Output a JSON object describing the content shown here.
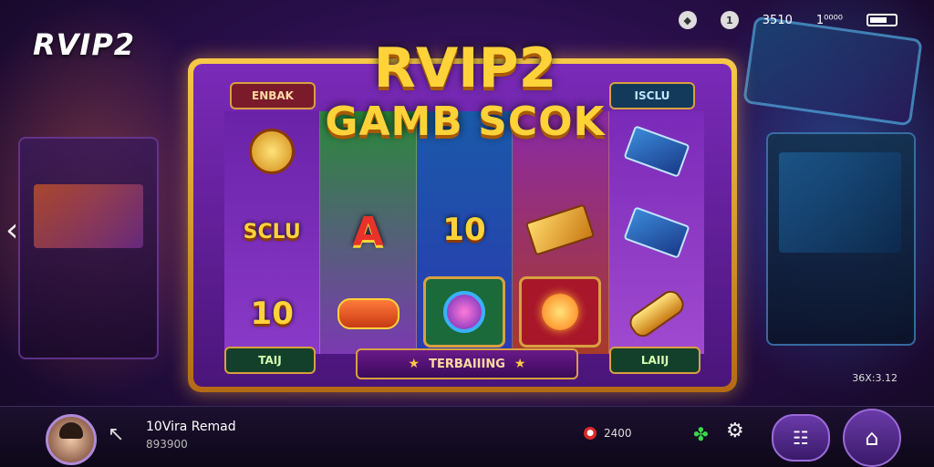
{
  "brand": "RVIP2",
  "status_bar": {
    "icon_1": "location-icon",
    "signal_label": "1",
    "time": "3510",
    "network": "1⁰⁰⁰⁰",
    "battery": "battery-icon"
  },
  "game": {
    "title_line1": "RVIP2",
    "title_line2": "GAMB SCOK",
    "plaques": {
      "top_left": "ENBAK",
      "top_right": "ISCLU",
      "bottom_left": "TAIJ",
      "bottom_right": "LAIIJ",
      "bottom_center": "TERBAIIING"
    },
    "reels": [
      [
        "gold-coin",
        "SCLU",
        "10"
      ],
      [
        "",
        "A",
        "sled"
      ],
      [
        "",
        "10",
        "gem"
      ],
      [
        "",
        "ticket",
        "sun"
      ],
      [
        "book",
        "book",
        "horn"
      ]
    ],
    "symbol_labels": {
      "sclu": "SCLU",
      "ten": "10",
      "a": "A",
      "ten2": "10"
    }
  },
  "timer": "36X:3.12",
  "player": {
    "name": "10Vira Remad",
    "id": "893900"
  },
  "balance": {
    "value": "2400",
    "icon": "coin-icon"
  },
  "colors": {
    "accent_gold": "#ffd23a",
    "frame_purple": "#7a2ab8",
    "bar_bg": "#1c1030",
    "button_purple": "#6a3aa8"
  }
}
